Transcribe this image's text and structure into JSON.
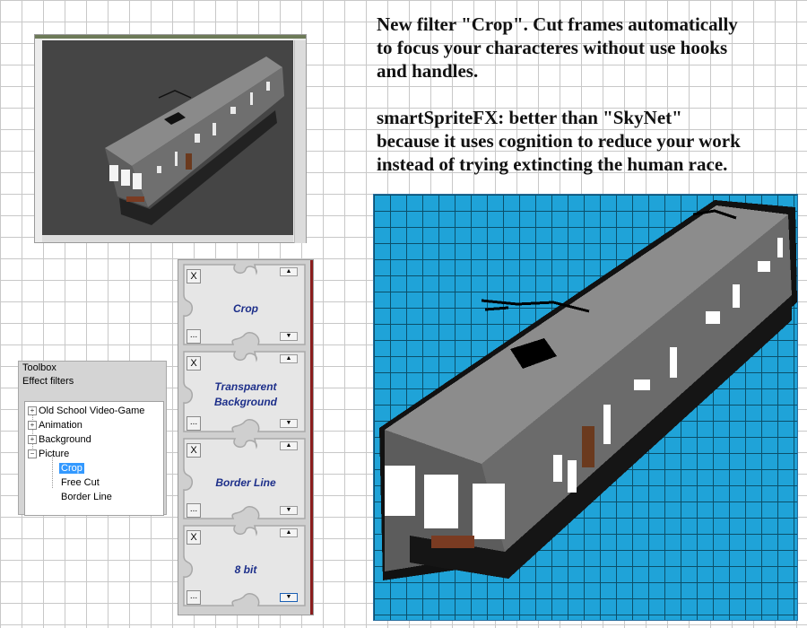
{
  "description": {
    "paragraph1": [
      "New filter \"Crop\". Cut frames automatically",
      "to focus your characteres without use hooks",
      "and handles."
    ],
    "paragraph2": [
      "smartSpriteFX: better than \"SkyNet\"",
      "because it uses cognition to reduce your work",
      "instead of trying extincting the human race."
    ]
  },
  "toolbox": {
    "title": "Toolbox",
    "subtitle": "Effect filters",
    "tree": [
      {
        "label": "Old School Video-Game",
        "expander": "+"
      },
      {
        "label": "Animation",
        "expander": "+"
      },
      {
        "label": "Background",
        "expander": "+"
      },
      {
        "label": "Picture",
        "expander": "−"
      },
      {
        "label": "Crop",
        "selected": true
      },
      {
        "label": "Free Cut"
      },
      {
        "label": "Border Line"
      }
    ]
  },
  "effects": [
    {
      "label": "Crop",
      "close": "X",
      "more": "...",
      "up": "▲",
      "down": "▼"
    },
    {
      "label": "Transparent Background",
      "close": "X",
      "more": "...",
      "up": "▲",
      "down": "▼"
    },
    {
      "label": "Border Line",
      "close": "X",
      "more": "...",
      "up": "▲",
      "down": "▼"
    },
    {
      "label": "8 bit",
      "close": "X",
      "more": "...",
      "up": "▲",
      "down": "▼"
    }
  ],
  "colors": {
    "sprite_background": "#1fa3d8",
    "train_body": "#6b6b6b",
    "label_text": "#1d2f8a",
    "selection": "#3399ff"
  }
}
